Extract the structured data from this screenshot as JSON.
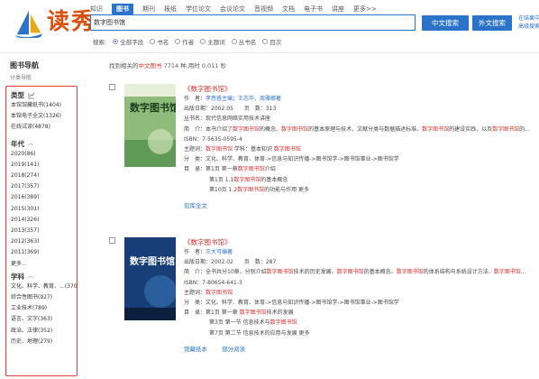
{
  "brand": {
    "logo_text": "读秀"
  },
  "nav": [
    "知识",
    "图书",
    "期刊",
    "报纸",
    "学位论文",
    "会议论文",
    "音视频",
    "文档",
    "电子书",
    "讲座",
    "更多>>"
  ],
  "nav_active_index": 1,
  "search": {
    "value": "数字图书馆",
    "btn_chinese": "中文搜索",
    "btn_foreign": "外文搜索",
    "side_links": [
      "在结果中",
      "高级搜索"
    ]
  },
  "filters": {
    "label": "搜索:",
    "options": [
      "全部字段",
      "书名",
      "作者",
      "主题词",
      "丛书名",
      "目次"
    ],
    "selected_index": 0
  },
  "sidebar": {
    "title": "图书导航",
    "subtitle": "分类导航",
    "type_heading": "类型",
    "type_items": [
      "本馆馆藏纸书(1404)",
      "本馆电子全文(1326)",
      "在线试读(4878)"
    ],
    "year_heading": "年代",
    "year_items": [
      "2020(86)",
      "2019(141)",
      "2018(274)",
      "2017(357)",
      "2016(389)",
      "2015(301)",
      "2014(326)",
      "2013(357)",
      "2012(363)",
      "2011(369)",
      "更多..."
    ],
    "subject_heading": "学科",
    "subject_items": [
      "文化、科学、教育、...(3709)",
      "综合性图书(927)",
      "工业技术(789)",
      "语言、文字(363)",
      "政治、法律(352)",
      "历史、地理(279)"
    ]
  },
  "results": {
    "prefix": "找到相关的",
    "type": "中文图书",
    "count": "7714",
    "suffix": "种,用时 0.011 秒"
  },
  "books": [
    {
      "title": "《数字图书馆》",
      "cover_title": "数字图书馆",
      "author_label": "作　者：",
      "author": "李思睿主编；王志华，周雅娜著",
      "pubdate_label": "出版日期：",
      "pubdate": "2002.05",
      "pages_label": "页　数：",
      "pages": "313",
      "series": "丛书名：现代信息网络实用技术讲座",
      "summary": "简　介：本书介绍了数字图书馆的概念、数字图书馆的基本原理与技术、文献分类与数据描述标准、数字图书馆的建设实践，以及数字图书馆的...",
      "isbn": "ISBN：7-5635-0595-4",
      "subject_words": "主题词：数字图书馆 学科：基本知识 数字图书馆",
      "classification": "分　类：文化、科学、教育、体育->信息与知识传播->图书馆学->图书馆事业->图书馆学",
      "toc_label": "目　录：",
      "toc": [
        "第1页 第一章数字图书馆介绍",
        "第1页 1.1数字图书馆的基本概念",
        "第10页 1.2数字图书馆的功能与作用 更多"
      ],
      "actions": [
        "包库全文"
      ]
    },
    {
      "title": "《数字图书馆》",
      "cover_title": "数字图书馆",
      "author_label": "作　者：",
      "author": "王大可编著",
      "pubdate_label": "出版日期：",
      "pubdate": "2002.02",
      "pages_label": "页　数：",
      "pages": "287",
      "summary": "简　介：全书共分10章，分别介绍数字图书馆技术的历史发展、数字图书馆的基本概念、数字图书馆的体系结构与系统设计方法、数字图书馆...",
      "isbn": "ISBN：7-80654-641-3",
      "subject_words": "主题词：数字图书馆",
      "classification": "分　类：文化、科学、教育、体育->信息与知识传播->图书馆学->图书馆事业->图书馆学",
      "toc_label": "目　录：",
      "toc": [
        "第1页 第一章 数字图书馆技术的发展",
        "第3页 第一节 信息技术与数字图书馆",
        "第7页 第二节 信息技术的应用与发展 更多"
      ],
      "actions": [
        "馆藏纸本",
        "部分阅读"
      ]
    }
  ],
  "colors": {
    "brand_blue": "#2b73c9",
    "accent_red": "#d32f2f",
    "logo_orange": "#d94f0e",
    "highlight_border": "#e53935"
  },
  "icons": [
    "logo-sail-icon",
    "chart-icon",
    "chevron-up-icon",
    "radio-icon",
    "checkbox-icon"
  ]
}
